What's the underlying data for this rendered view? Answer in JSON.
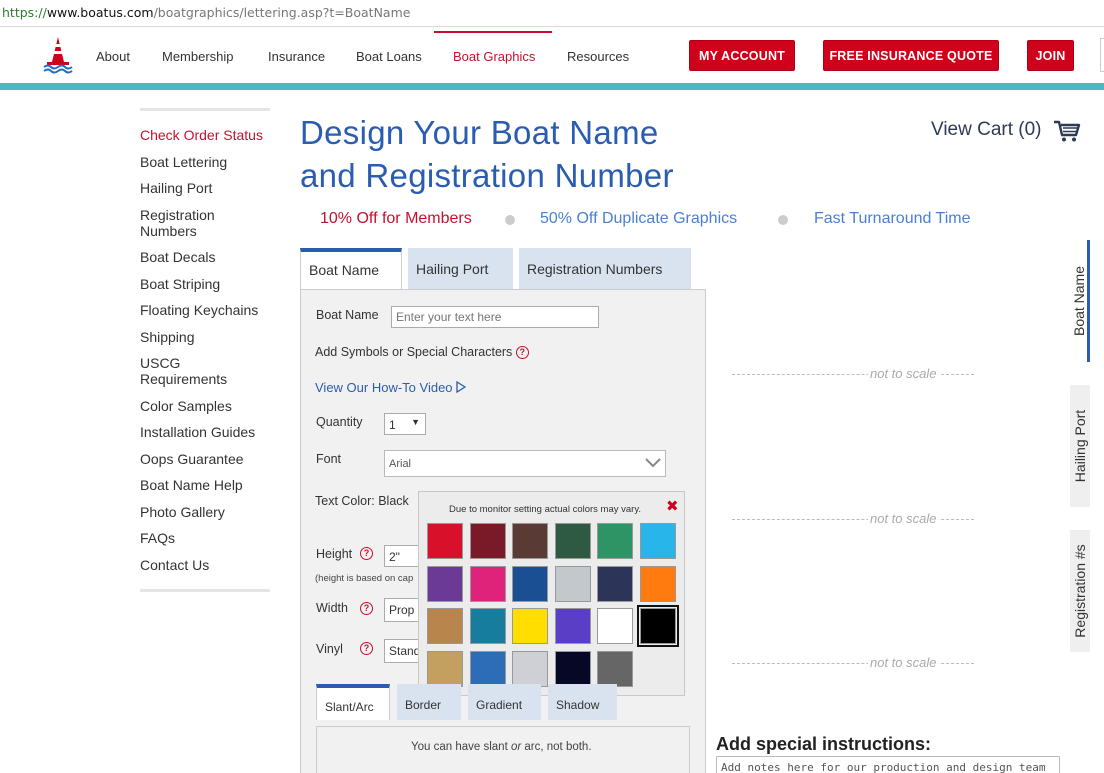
{
  "browser": {
    "url_scheme": "https://",
    "url_host": "www.boatus.com",
    "url_path": "/boatgraphics/lettering.asp?t=BoatName"
  },
  "nav": {
    "links": [
      "About",
      "Membership",
      "Insurance",
      "Boat Loans",
      "Boat Graphics",
      "Resources"
    ],
    "active": "Boat Graphics",
    "buttons": {
      "account": "MY ACCOUNT",
      "quote": "FREE INSURANCE QUOTE",
      "join": "JOIN"
    }
  },
  "sidebar": {
    "items": [
      "Check Order Status",
      "Boat Lettering",
      "Hailing Port",
      "Registration Numbers",
      "Boat Decals",
      "Boat Striping",
      "Floating Keychains",
      "Shipping",
      "USCG Requirements",
      "Color Samples",
      "Installation Guides",
      "Oops Guarantee",
      "Boat Name Help",
      "Photo Gallery",
      "FAQs",
      "Contact Us"
    ]
  },
  "header": {
    "title_line1": "Design Your Boat Name",
    "title_line2": "and Registration Number",
    "perk1": "10% Off for Members",
    "perk2": "50% Off Duplicate Graphics",
    "perk3": "Fast Turnaround Time",
    "cart": "View Cart (0)"
  },
  "tabs": [
    "Boat Name",
    "Hailing Port",
    "Registration Numbers"
  ],
  "form": {
    "boat_name_label": "Boat Name",
    "boat_name_placeholder": "Enter your text here",
    "symbols_label": "Add Symbols or Special Characters",
    "howto": "View Our How-To Video",
    "quantity_label": "Quantity",
    "quantity_value": "1",
    "font_label": "Font",
    "font_value": "Arial",
    "text_color_label": "Text Color: Black",
    "height_label": "Height",
    "height_value": "2\"",
    "height_note": "(height is based on cap",
    "width_label": "Width",
    "width_value": "Prop",
    "vinyl_label": "Vinyl",
    "vinyl_value": "Stand"
  },
  "color_popup": {
    "note": "Due to monitor setting actual colors may vary.",
    "selected": "#000000",
    "colors": [
      [
        "#d8102a",
        "#7a1a28",
        "#5a3a34",
        "#2e5a44",
        "#2e9466",
        "#27b5ea"
      ],
      [
        "#6a3a96",
        "#e0237a",
        "#1b4f94",
        "#c3c8cc",
        "#2c3458",
        "#ff7b10"
      ],
      [
        "#b8864c",
        "#177d9e",
        "#ffde00",
        "#5a3ec6",
        "#ffffff",
        "#000000"
      ],
      [
        "#c4a060",
        "#2d6db8",
        "#cfcfd6",
        "#060826",
        "#666666"
      ]
    ]
  },
  "subtabs": [
    "Slant/Arc",
    "Border",
    "Gradient",
    "Shadow"
  ],
  "sub_note_prefix": "You can have slant ",
  "sub_note_or": "or",
  "sub_note_suffix": " arc, not both.",
  "preview": {
    "scale_text": "not to scale",
    "side_tabs": [
      "Boat Name",
      "Hailing Port",
      "Registration #s"
    ]
  },
  "instructions": {
    "title": "Add special instructions:",
    "placeholder": "Add notes here for our production and design team"
  }
}
